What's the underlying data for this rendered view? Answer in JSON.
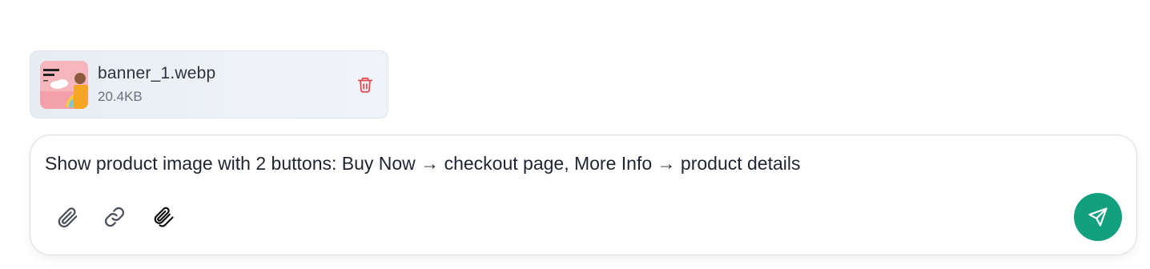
{
  "attachment": {
    "file_name": "banner_1.webp",
    "file_size": "20.4KB",
    "thumbnail_icon": "banner-thumbnail",
    "delete_icon": "trash-icon",
    "delete_color": "#e5484d"
  },
  "composer": {
    "text": "Show product image with 2 buttons: Buy Now → checkout page, More Info → product details",
    "tools": [
      {
        "name": "attach-file-icon"
      },
      {
        "name": "link-icon"
      },
      {
        "name": "multi-attach-icon"
      }
    ],
    "send_icon": "send-icon",
    "send_color": "#12a07f"
  }
}
